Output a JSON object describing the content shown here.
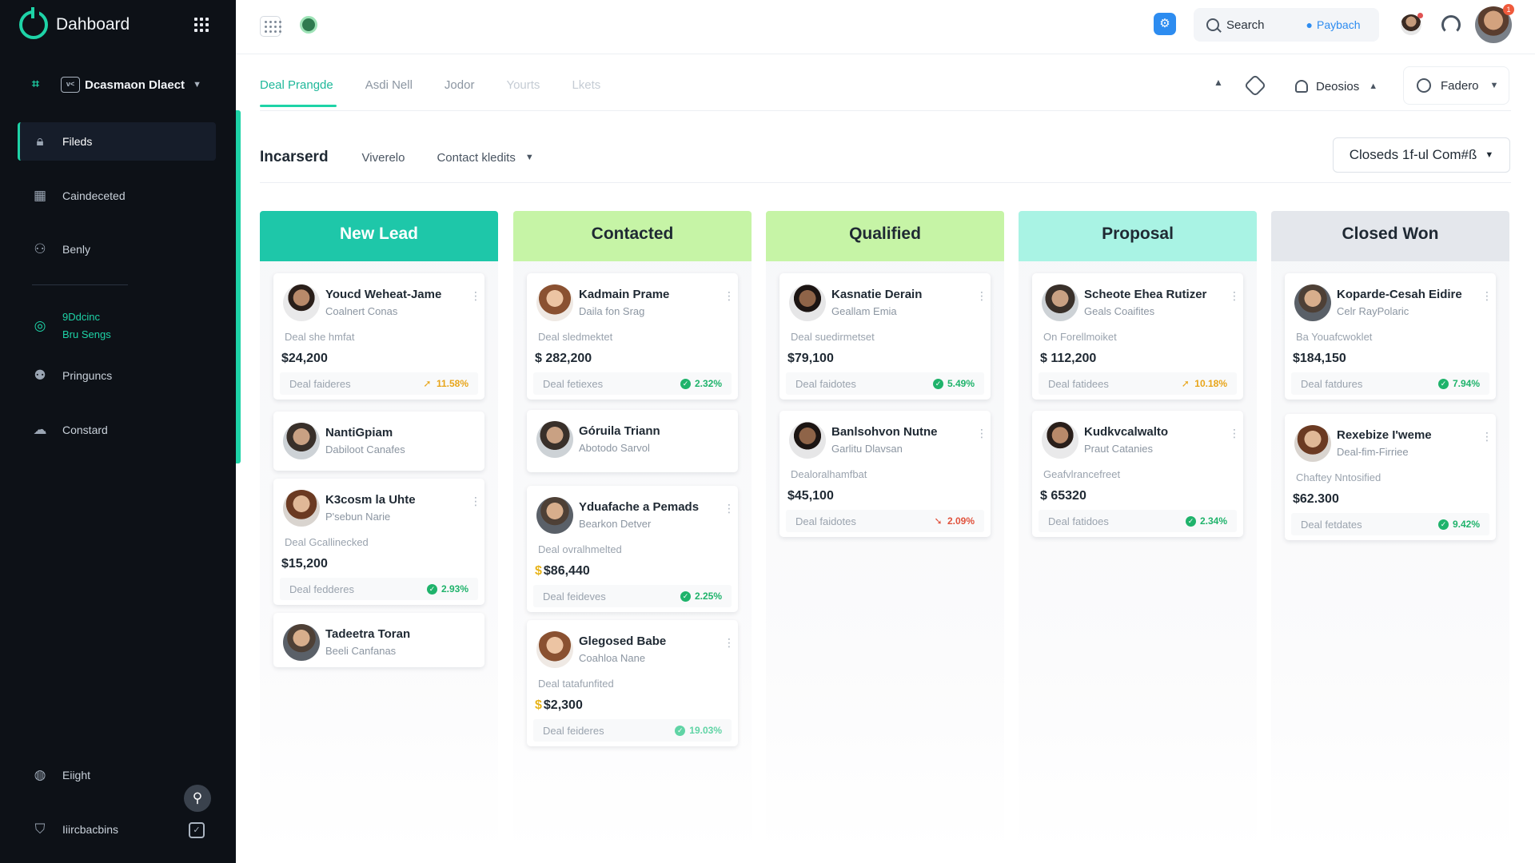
{
  "app": {
    "title": "Dahboard"
  },
  "sidebar": {
    "workspace": {
      "label": "Dcasmaon Dlaect",
      "box": "v<"
    },
    "items": [
      {
        "label": "Fileds",
        "icon": "lock-icon",
        "active": true
      },
      {
        "label": "Caindeceted",
        "icon": "calendar-icon"
      },
      {
        "label": "Benly",
        "icon": "users-icon"
      },
      {
        "label_line1": "9Ddcinc",
        "label_line2": "Bru Sengs",
        "icon": "target-icon",
        "accent": "#1ed3a7"
      },
      {
        "label": "Pringuncs",
        "icon": "people-icon"
      },
      {
        "label": "Constard",
        "icon": "cloud-icon"
      }
    ],
    "bottom": [
      {
        "label": "Eiight",
        "icon": "globe-icon"
      },
      {
        "label": "Iiircbacbins",
        "icon": "shield-icon"
      }
    ]
  },
  "topbar": {
    "search_label": "Search",
    "profile_label": "Paybach",
    "notification_count": "1"
  },
  "tabs": [
    {
      "label": "Deal Prangde",
      "active": true
    },
    {
      "label": "Asdi Nell"
    },
    {
      "label": "Jodor"
    },
    {
      "label": "Yourts",
      "faded": true
    },
    {
      "label": "Lkets",
      "faded": true
    }
  ],
  "tools": {
    "notifications_label": "Deosios",
    "filter_label": "Fadero"
  },
  "filter_row": {
    "title": "Incarserd",
    "view": "Viverelo",
    "contact": "Contact kledits",
    "closed_select": "Closeds 1f-ul Com#ß"
  },
  "columns": [
    {
      "title": "New Lead",
      "cards": [
        {
          "name": "Youcd Weheat-Jame",
          "sub": "Coalnert Conas",
          "desc": "Deal she hmfat",
          "amount": "$24,200",
          "foot": "Deal faideres",
          "pct": "11.58%",
          "trend": "up"
        },
        {
          "name": "NantiGpiam",
          "sub": "Dabiloot Canafes"
        },
        {
          "name": "K3cosm la Uhte",
          "sub": "P'sebun Narie",
          "desc": "Deal Gcallinecked",
          "amount": "$15,200",
          "foot": "Deal fedderes",
          "pct": "2.93%",
          "trend": "check"
        },
        {
          "name": "Tadeetra Toran",
          "sub": "Beeli Canfanas"
        }
      ]
    },
    {
      "title": "Contacted",
      "cards": [
        {
          "name": "Kadmain Prame",
          "sub": "Daila fon Srag",
          "desc": "Deal sledmektet",
          "amount": "$ 282,200",
          "foot": "Deal fetiexes",
          "pct": "2.32%",
          "trend": "check"
        },
        {
          "name": "Góruila Triann",
          "sub": "Abotodo Sarvol"
        },
        {
          "name": "Yduafache a Pemads",
          "sub": "Bearkon Detver",
          "desc": "Deal ovralhmelted",
          "amount": "$86,440",
          "foot": "Deal feideves",
          "pct": "2.25%",
          "trend": "check"
        },
        {
          "name": "Glegosed Babe",
          "sub": "Coahloa Nane",
          "desc": "Deal tatafunfited",
          "amount": "$2,300",
          "foot": "Deal feideres",
          "pct": "19.03%",
          "trend": "check-lite"
        }
      ]
    },
    {
      "title": "Qualified",
      "cards": [
        {
          "name": "Kasnatie Derain",
          "sub": "Geallam Emia",
          "desc": "Deal suedirmetset",
          "amount": "$79,100",
          "foot": "Deal faidotes",
          "pct": "5.49%",
          "trend": "check"
        },
        {
          "name": "Banlsohvon Nutne",
          "sub": "Garlitu Dlavsan",
          "desc": "Dealoralhamfbat",
          "amount": "$45,100",
          "foot": "Deal faidotes",
          "pct": "2.09%",
          "trend": "down"
        }
      ]
    },
    {
      "title": "Proposal",
      "cards": [
        {
          "name": "Scheote Ehea Rutizer",
          "sub": "Geals Coaifites",
          "desc": "On Forellmoiket",
          "amount": "$ 112,200",
          "foot": "Deal fatidees",
          "pct": "10.18%",
          "trend": "up"
        },
        {
          "name": "Kudkvcalwalto",
          "sub": "Praut Catanies",
          "desc": "Geafvlrancefreet",
          "amount": "$ 65320",
          "foot": "Deal fatidoes",
          "pct": "2.34%",
          "trend": "check"
        }
      ]
    },
    {
      "title": "Closed Won",
      "cards": [
        {
          "name": "Koparde-Cesah Eidire",
          "sub": "Celr RayPolaric",
          "desc": "Ba Youafcwoklet",
          "amount": "$184,150",
          "foot": "Deal fatdures",
          "pct": "7.94%",
          "trend": "check"
        },
        {
          "name": "Rexebize I'weme",
          "sub": "Deal-fim-Firriee",
          "desc": "Chaftey Nntosified",
          "amount": "$62.300",
          "foot": "Deal fetdates",
          "pct": "9.42%",
          "trend": "check"
        }
      ]
    }
  ]
}
